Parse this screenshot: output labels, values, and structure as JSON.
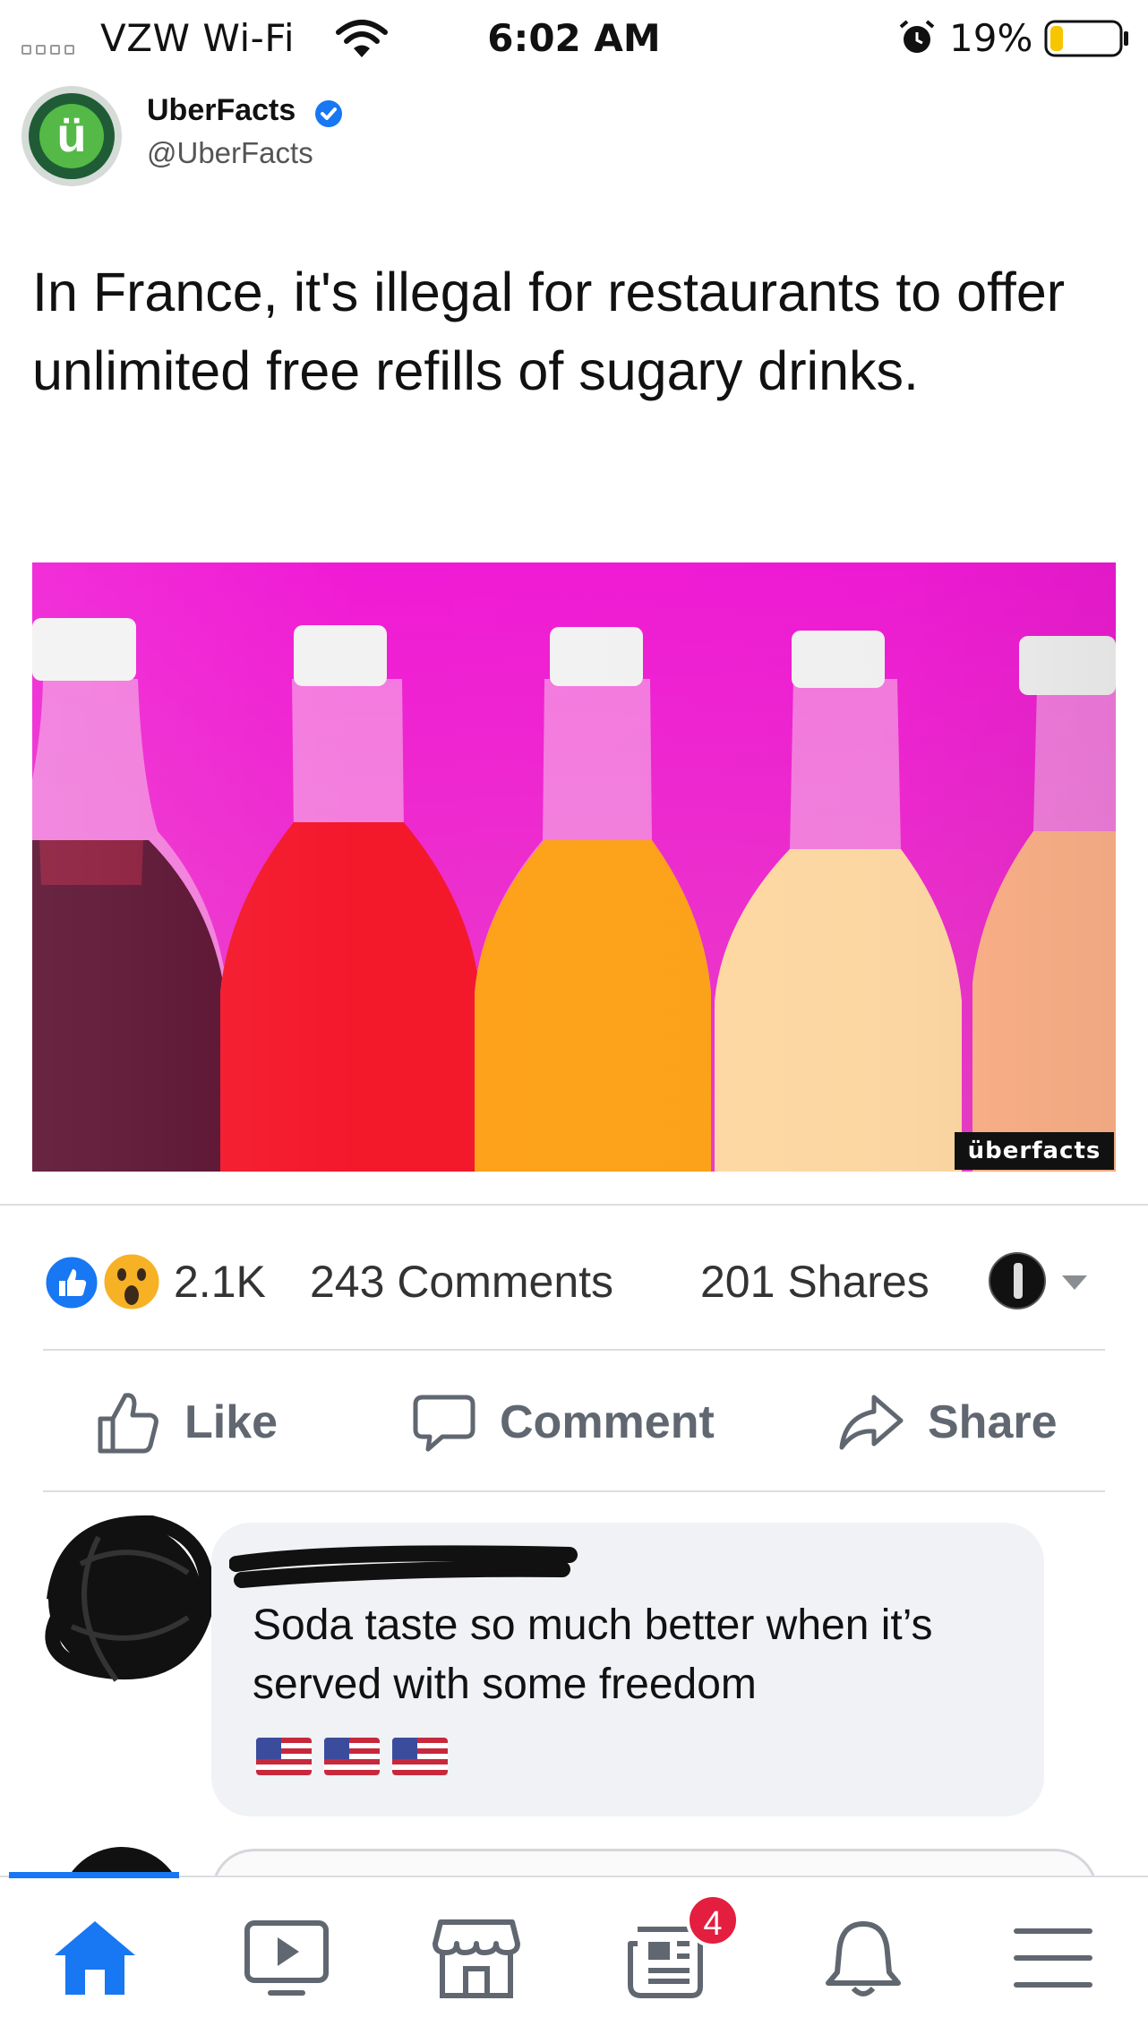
{
  "status_bar": {
    "carrier": "VZW Wi-Fi",
    "time": "6:02 AM",
    "battery": "19%",
    "battery_level": 0.19
  },
  "post": {
    "page_name": "UberFacts",
    "handle": "@UberFacts",
    "avatar_letter": "ü",
    "text": "In France, it's illegal for restaurants to offer unlimited free refills of sugary drinks.",
    "photo_caption": "überfacts"
  },
  "stats": {
    "reactions": "2.1K",
    "comments": "243 Comments",
    "shares": "201 Shares"
  },
  "actions": {
    "like": "Like",
    "comment": "Comment",
    "share": "Share"
  },
  "comment": {
    "text": "Soda taste so much better when it’s served with some freedom",
    "emojis": [
      "us-flag",
      "us-flag",
      "us-flag"
    ]
  },
  "tab_bar": {
    "items": [
      "home-icon",
      "watch-icon",
      "marketplace-icon",
      "news-icon",
      "bell-icon",
      "menu-icon"
    ],
    "active": "home-icon",
    "news_badge": "4"
  },
  "colors": {
    "accent": "#1877f2",
    "badge": "#e41e3f",
    "photo_background": "#ee18d0",
    "brand_green": "#54b946"
  }
}
